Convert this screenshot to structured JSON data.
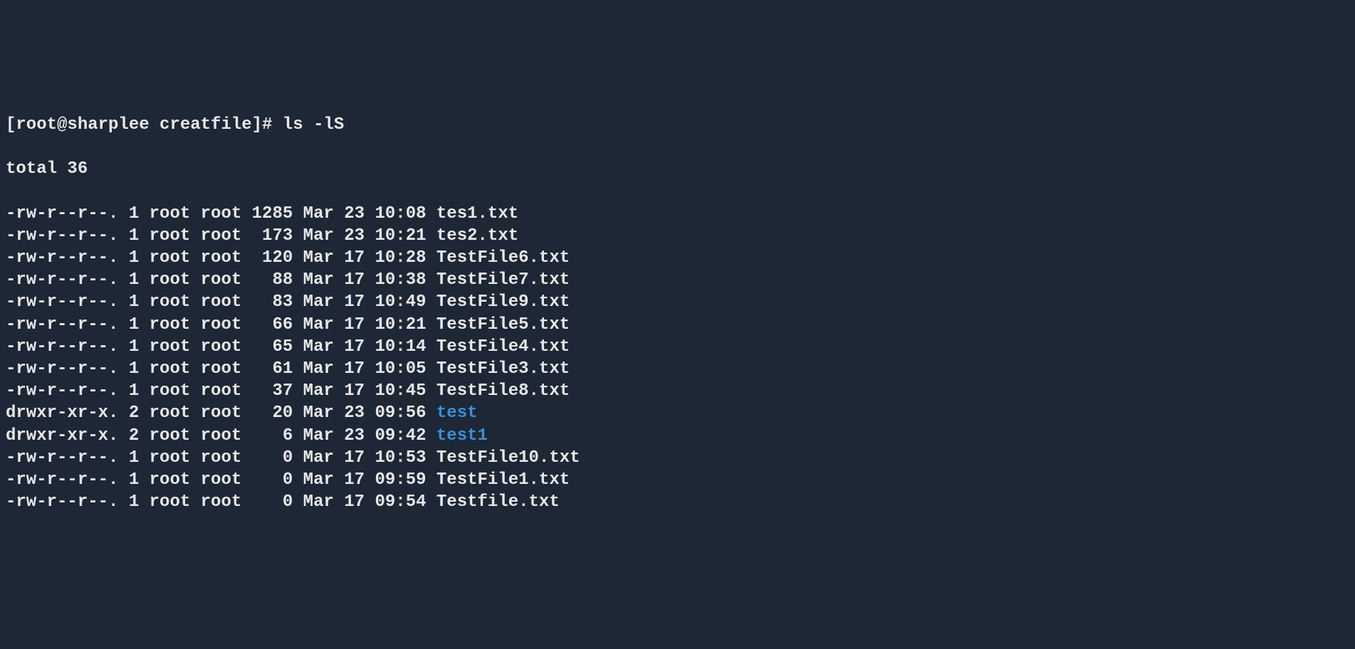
{
  "prompt": "[root@sharplee creatfile]# ",
  "command": "ls -lS",
  "total_line": "total 36",
  "entries": [
    {
      "perms": "-rw-r--r--.",
      "links": "1",
      "owner": "root",
      "group": "root",
      "size": "1285",
      "month": "Mar",
      "day": "23",
      "time": "10:08",
      "name": "tes1.txt",
      "isdir": false
    },
    {
      "perms": "-rw-r--r--.",
      "links": "1",
      "owner": "root",
      "group": "root",
      "size": " 173",
      "month": "Mar",
      "day": "23",
      "time": "10:21",
      "name": "tes2.txt",
      "isdir": false
    },
    {
      "perms": "-rw-r--r--.",
      "links": "1",
      "owner": "root",
      "group": "root",
      "size": " 120",
      "month": "Mar",
      "day": "17",
      "time": "10:28",
      "name": "TestFile6.txt",
      "isdir": false
    },
    {
      "perms": "-rw-r--r--.",
      "links": "1",
      "owner": "root",
      "group": "root",
      "size": "  88",
      "month": "Mar",
      "day": "17",
      "time": "10:38",
      "name": "TestFile7.txt",
      "isdir": false
    },
    {
      "perms": "-rw-r--r--.",
      "links": "1",
      "owner": "root",
      "group": "root",
      "size": "  83",
      "month": "Mar",
      "day": "17",
      "time": "10:49",
      "name": "TestFile9.txt",
      "isdir": false
    },
    {
      "perms": "-rw-r--r--.",
      "links": "1",
      "owner": "root",
      "group": "root",
      "size": "  66",
      "month": "Mar",
      "day": "17",
      "time": "10:21",
      "name": "TestFile5.txt",
      "isdir": false
    },
    {
      "perms": "-rw-r--r--.",
      "links": "1",
      "owner": "root",
      "group": "root",
      "size": "  65",
      "month": "Mar",
      "day": "17",
      "time": "10:14",
      "name": "TestFile4.txt",
      "isdir": false
    },
    {
      "perms": "-rw-r--r--.",
      "links": "1",
      "owner": "root",
      "group": "root",
      "size": "  61",
      "month": "Mar",
      "day": "17",
      "time": "10:05",
      "name": "TestFile3.txt",
      "isdir": false
    },
    {
      "perms": "-rw-r--r--.",
      "links": "1",
      "owner": "root",
      "group": "root",
      "size": "  37",
      "month": "Mar",
      "day": "17",
      "time": "10:45",
      "name": "TestFile8.txt",
      "isdir": false
    },
    {
      "perms": "drwxr-xr-x.",
      "links": "2",
      "owner": "root",
      "group": "root",
      "size": "  20",
      "month": "Mar",
      "day": "23",
      "time": "09:56",
      "name": "test",
      "isdir": true
    },
    {
      "perms": "drwxr-xr-x.",
      "links": "2",
      "owner": "root",
      "group": "root",
      "size": "   6",
      "month": "Mar",
      "day": "23",
      "time": "09:42",
      "name": "test1",
      "isdir": true
    },
    {
      "perms": "-rw-r--r--.",
      "links": "1",
      "owner": "root",
      "group": "root",
      "size": "   0",
      "month": "Mar",
      "day": "17",
      "time": "10:53",
      "name": "TestFile10.txt",
      "isdir": false
    },
    {
      "perms": "-rw-r--r--.",
      "links": "1",
      "owner": "root",
      "group": "root",
      "size": "   0",
      "month": "Mar",
      "day": "17",
      "time": "09:59",
      "name": "TestFile1.txt",
      "isdir": false
    },
    {
      "perms": "-rw-r--r--.",
      "links": "1",
      "owner": "root",
      "group": "root",
      "size": "   0",
      "month": "Mar",
      "day": "17",
      "time": "09:54",
      "name": "Testfile.txt",
      "isdir": false
    }
  ]
}
